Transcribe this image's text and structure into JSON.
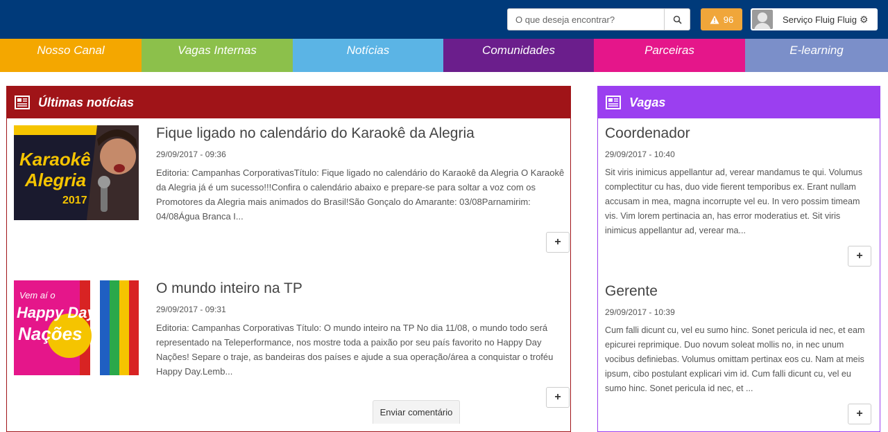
{
  "header": {
    "search": {
      "placeholder": "O que deseja encontrar?"
    },
    "alerts": {
      "count": "96",
      "icon": "warning-icon",
      "color": "#f0a63a"
    },
    "user": {
      "name": "Serviço Fluig Fluig",
      "icon": "gear-icon"
    },
    "background": "#003a7a"
  },
  "nav": [
    {
      "label": "Nosso Canal",
      "color": "#f4a700"
    },
    {
      "label": "Vagas Internas",
      "color": "#8cc04b"
    },
    {
      "label": "Notícias",
      "color": "#5bb4e5"
    },
    {
      "label": "Comunidades",
      "color": "#6b1e8c"
    },
    {
      "label": "Parceiras",
      "color": "#e5168a"
    },
    {
      "label": "E-learning",
      "color": "#7b8fc9"
    }
  ],
  "news_panel": {
    "title": "Últimas notícias",
    "color": "#a01418",
    "items": [
      {
        "title": "Fique ligado no calendário do Karaokê da Alegria",
        "date": "29/09/2017 - 09:36",
        "text": "Editoria: Campanhas CorporativasTítulo: Fique ligado no calendário do Karaokê da Alegria O Karaokê da Alegria já é um sucesso!!!Confira o calendário abaixo e prepare-se para soltar a voz com os Promotores da Alegria mais animados do Brasil!São Gonçalo do Amarante: 03/08Parnamirim: 04/08Água Branca I...",
        "image_text": [
          "Karaokê",
          "Alegria",
          "2017"
        ]
      },
      {
        "title": "O mundo inteiro na TP",
        "date": "29/09/2017 - 09:31",
        "text": "Editoria: Campanhas Corporativas Título: O mundo inteiro na TP No dia 11/08, o mundo todo será representado na Teleperformance, nos mostre toda a paixão por seu país favorito no Happy Day Nações! Separe o traje, as bandeiras dos países e ajude a sua operação/área a conquistar o troféu Happy Day.Lemb...",
        "image_text": [
          "Vem aí o",
          "Happy Day",
          "Nações"
        ]
      }
    ]
  },
  "jobs_panel": {
    "title": "Vagas",
    "color": "#9b3ff0",
    "items": [
      {
        "title": "Coordenador",
        "date": "29/09/2017 - 10:40",
        "text": "Sit viris inimicus appellantur ad, verear mandamus te qui. Volumus complectitur cu has, duo vide fierent temporibus ex. Erant nullam accusam in mea, magna incorrupte vel eu. In vero possim timeam vis. Vim lorem pertinacia an, has error moderatius et. Sit viris inimicus appellantur ad, verear ma..."
      },
      {
        "title": "Gerente",
        "date": "29/09/2017 - 10:39",
        "text": "Cum falli dicunt cu, vel eu sumo hinc. Sonet pericula id nec, et eam epicurei reprimique. Duo novum soleat mollis no, in nec unum vocibus definiebas. Volumus omittam pertinax eos cu. Nam at meis ipsum, cibo postulant explicari vim id. Cum falli dicunt cu, vel eu sumo hinc. Sonet pericula id nec, et ..."
      }
    ]
  },
  "more_label": "+",
  "comment_button": "Enviar comentário"
}
